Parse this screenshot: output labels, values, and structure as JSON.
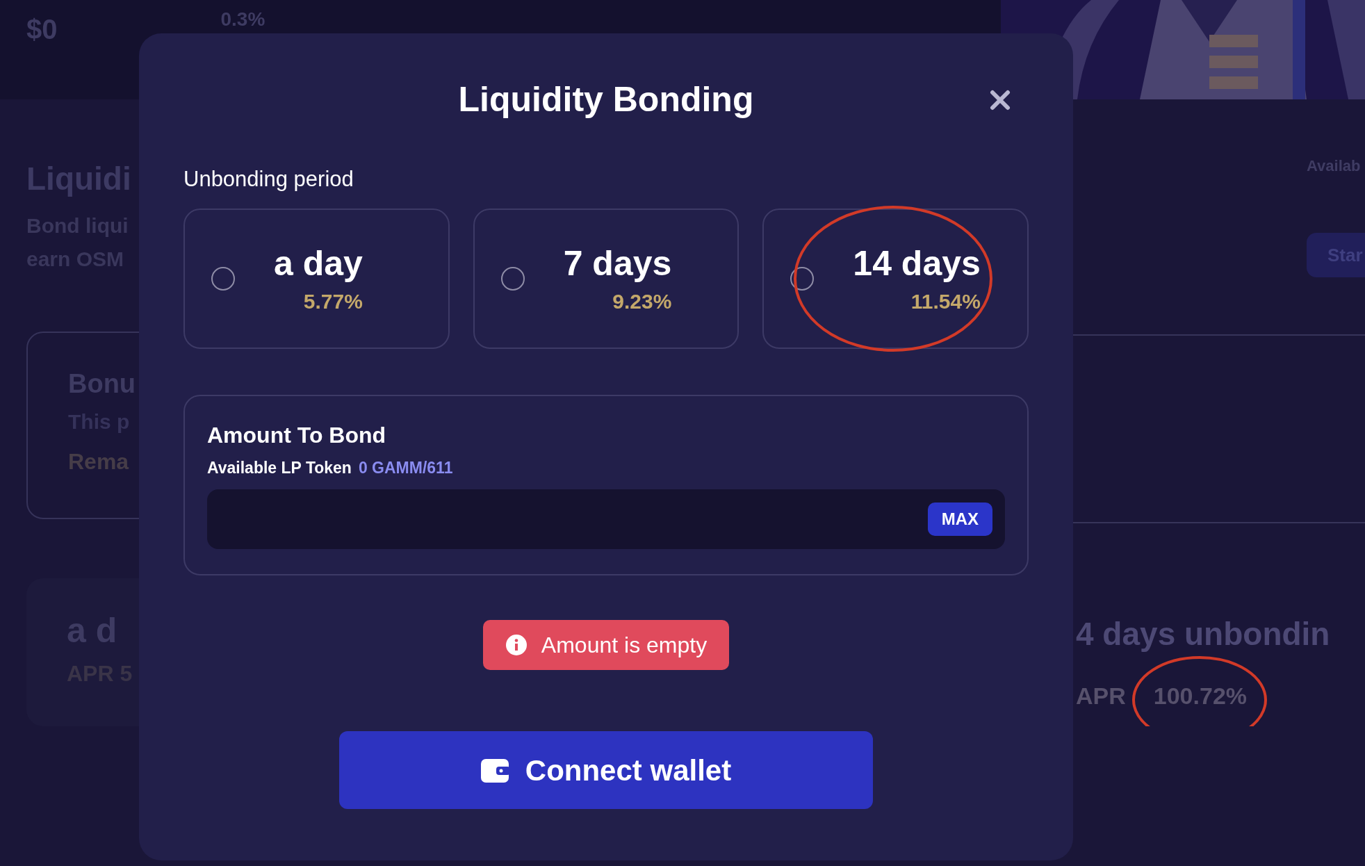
{
  "background": {
    "stats": [
      "$0",
      "0.3%"
    ],
    "heading": "Liquidi",
    "description": [
      "Bond liqui",
      "earn OSM"
    ],
    "bonus_card": {
      "title": "Bonu",
      "text": "This p",
      "remaining": "Rema"
    },
    "left_bond_card": {
      "title": "a d",
      "apr": "APR 5"
    },
    "available_label": "Availab",
    "start_button": "Star",
    "right_bond_card": {
      "title": "4 days unbondin",
      "apr_label": "APR",
      "apr_value": "100.72%"
    }
  },
  "modal": {
    "title": "Liquidity Bonding",
    "section_label": "Unbonding period",
    "options": [
      {
        "duration": "a day",
        "apr": "5.77%",
        "selected": false
      },
      {
        "duration": "7 days",
        "apr": "9.23%",
        "selected": false
      },
      {
        "duration": "14 days",
        "apr": "11.54%",
        "selected": false
      }
    ],
    "amount": {
      "title": "Amount To Bond",
      "available_label": "Available LP Token",
      "available_value": "0 GAMM/611",
      "max_button": "MAX"
    },
    "error": "Amount is empty",
    "connect_button": "Connect wallet"
  }
}
